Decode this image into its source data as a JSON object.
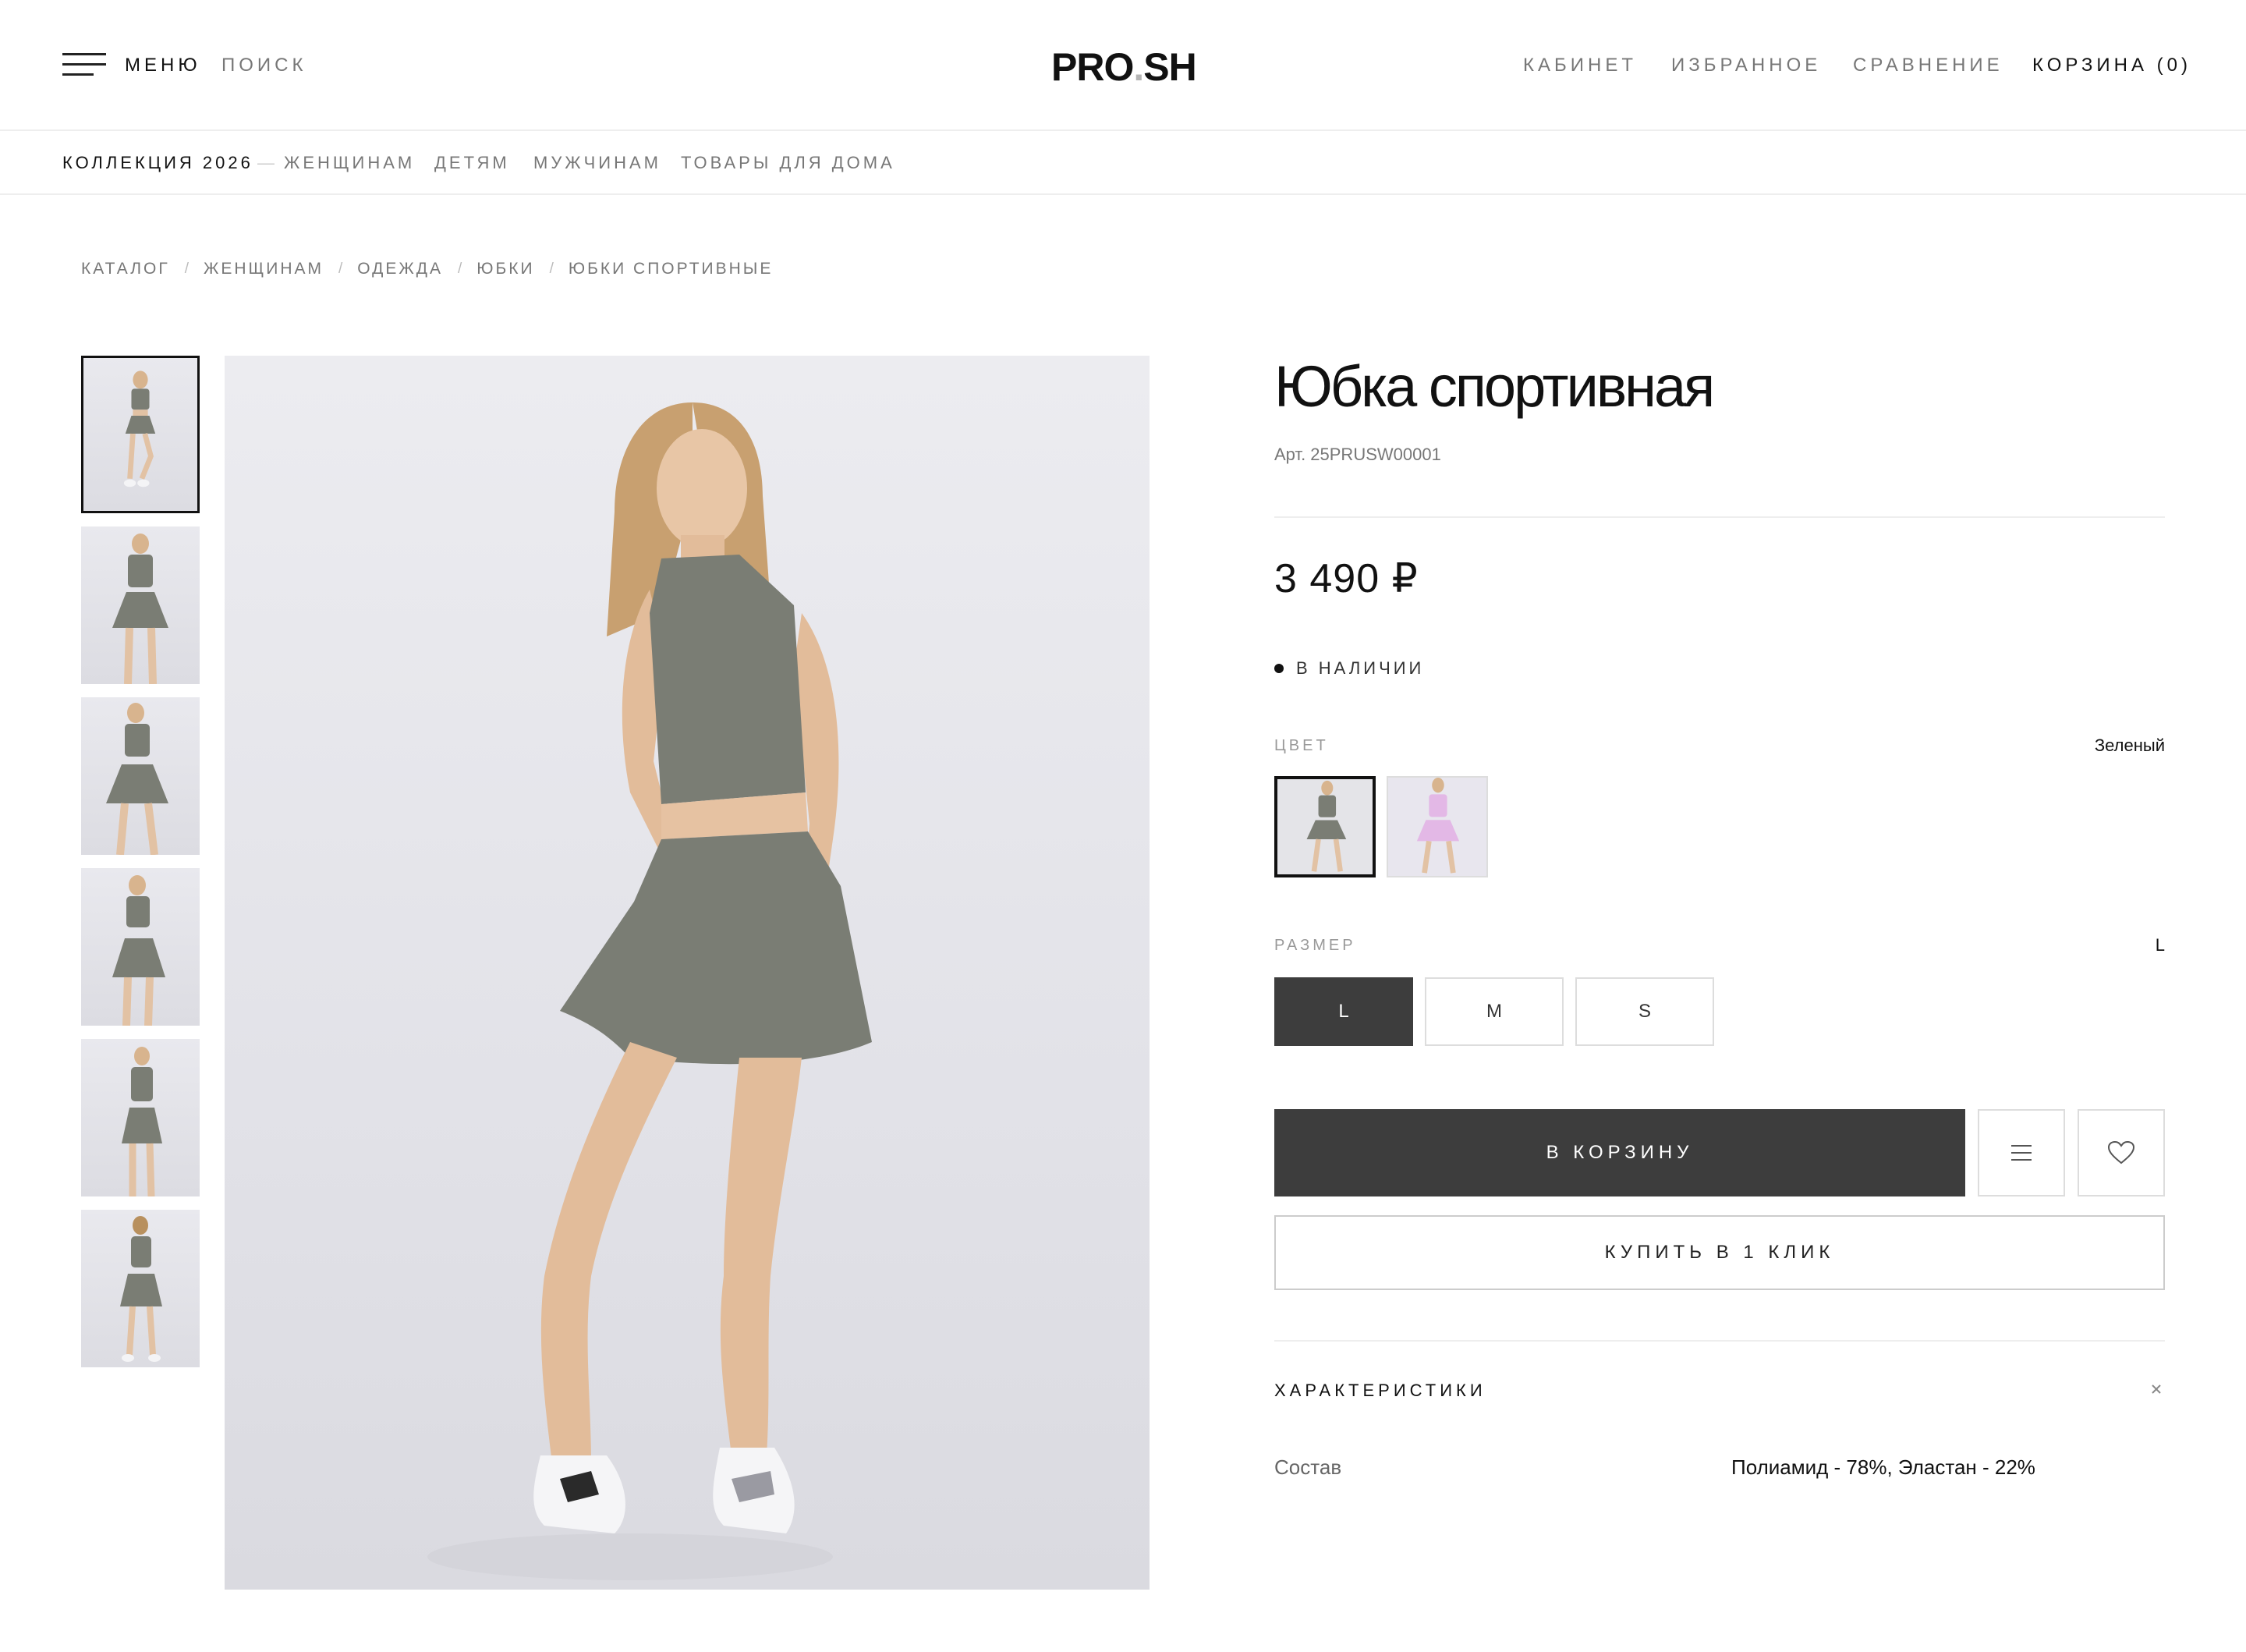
{
  "header": {
    "menu_label": "МЕНЮ",
    "search_label": "ПОИСК",
    "logo_left": "PRO",
    "logo_dot": ".",
    "logo_right": "SH",
    "cabinet": "КАБИНЕТ",
    "favorites": "ИЗБРАННОЕ",
    "compare": "СРАВНЕНИЕ",
    "cart": "КОРЗИНА (0)"
  },
  "catnav": {
    "items": [
      "КОЛЛЕКЦИЯ 2026",
      "ЖЕНЩИНАМ",
      "ДЕТЯМ",
      "МУЖЧИНАМ",
      "ТОВАРЫ ДЛЯ ДОМА"
    ],
    "separator": "—"
  },
  "breadcrumb": {
    "items": [
      "КАТАЛОГ",
      "ЖЕНЩИНАМ",
      "ОДЕЖДА",
      "ЮБКИ",
      "ЮБКИ СПОРТИВНЫЕ"
    ],
    "separator": "/"
  },
  "product": {
    "title": "Юбка спортивная",
    "sku": "Арт. 25PRUSW00001",
    "price": "3 490 ₽",
    "stock": "В НАЛИЧИИ",
    "color_label": "ЦВЕТ",
    "color_value": "Зеленый",
    "size_label": "РАЗМЕР",
    "size_value": "L",
    "sizes": [
      "L",
      "M",
      "S"
    ],
    "add_to_cart": "В КОРЗИНУ",
    "buy_one_click": "КУПИТЬ В 1 КЛИК",
    "specs_title": "ХАРАКТЕРИСТИКИ",
    "specs": [
      {
        "key": "Состав",
        "value": "Полиамид - 78%, Эластан - 22%"
      }
    ]
  },
  "colors": {
    "accent_dark": "#3d3d3d",
    "garment_green": "#7a7d74",
    "garment_pink": "#e3b8e6"
  },
  "icons": [
    "hamburger-icon",
    "compare-list-icon",
    "heart-icon",
    "close-icon"
  ]
}
